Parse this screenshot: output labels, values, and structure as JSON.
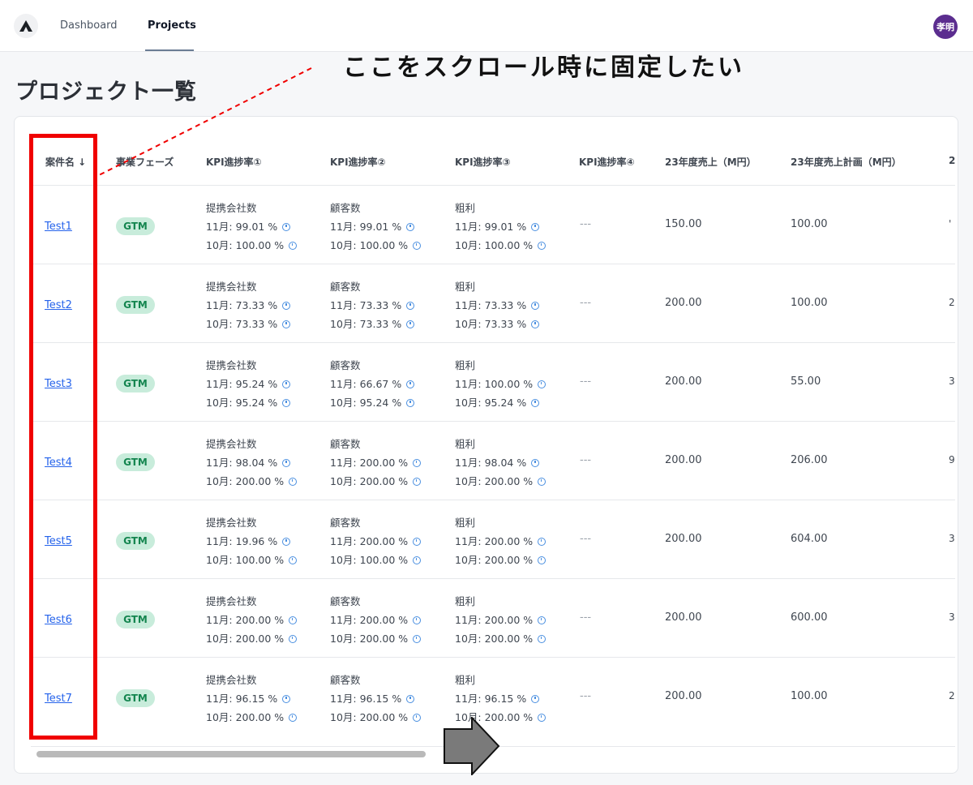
{
  "nav": {
    "dashboard": "Dashboard",
    "projects": "Projects",
    "avatar": "孝明"
  },
  "page": {
    "title": "プロジェクト一覧"
  },
  "annotation": {
    "text": "ここをスクロール時に固定したい"
  },
  "table": {
    "headers": {
      "name": "案件名 ↓",
      "phase": "事業フェーズ",
      "kpi1": "KPI進捗率①",
      "kpi2": "KPI進捗率②",
      "kpi3": "KPI進捗率③",
      "kpi4": "KPI進捗率④",
      "sales23": "23年度売上（M円）",
      "plan23": "23年度売上計画（M円）",
      "cut": "2"
    },
    "rows": [
      {
        "name": "Test1",
        "phase": "GTM",
        "kpi1": {
          "label": "提携会社数",
          "nov": "11月: 99.01 %",
          "oct": "10月: 100.00 %"
        },
        "kpi2": {
          "label": "顧客数",
          "nov": "11月: 99.01 %",
          "oct": "10月: 100.00 %"
        },
        "kpi3": {
          "label": "粗利",
          "nov": "11月: 99.01 %",
          "oct": "10月: 100.00 %"
        },
        "kpi4": "---",
        "sales": "150.00",
        "plan": "100.00",
        "cut": "'"
      },
      {
        "name": "Test2",
        "phase": "GTM",
        "kpi1": {
          "label": "提携会社数",
          "nov": "11月: 73.33 %",
          "oct": "10月: 73.33 %"
        },
        "kpi2": {
          "label": "顧客数",
          "nov": "11月: 73.33 %",
          "oct": "10月: 73.33 %"
        },
        "kpi3": {
          "label": "粗利",
          "nov": "11月: 73.33 %",
          "oct": "10月: 73.33 %"
        },
        "kpi4": "---",
        "sales": "200.00",
        "plan": "100.00",
        "cut": "2"
      },
      {
        "name": "Test3",
        "phase": "GTM",
        "kpi1": {
          "label": "提携会社数",
          "nov": "11月: 95.24 %",
          "oct": "10月: 95.24 %"
        },
        "kpi2": {
          "label": "顧客数",
          "nov": "11月: 66.67 %",
          "oct": "10月: 95.24 %"
        },
        "kpi3": {
          "label": "粗利",
          "nov": "11月: 100.00 %",
          "oct": "10月: 95.24 %"
        },
        "kpi4": "---",
        "sales": "200.00",
        "plan": "55.00",
        "cut": "3"
      },
      {
        "name": "Test4",
        "phase": "GTM",
        "kpi1": {
          "label": "提携会社数",
          "nov": "11月: 98.04 %",
          "oct": "10月: 200.00 %"
        },
        "kpi2": {
          "label": "顧客数",
          "nov": "11月: 200.00 %",
          "oct": "10月: 200.00 %"
        },
        "kpi3": {
          "label": "粗利",
          "nov": "11月: 98.04 %",
          "oct": "10月: 200.00 %"
        },
        "kpi4": "---",
        "sales": "200.00",
        "plan": "206.00",
        "cut": "9"
      },
      {
        "name": "Test5",
        "phase": "GTM",
        "kpi1": {
          "label": "提携会社数",
          "nov": "11月: 19.96 %",
          "oct": "10月: 100.00 %"
        },
        "kpi2": {
          "label": "顧客数",
          "nov": "11月: 200.00 %",
          "oct": "10月: 100.00 %"
        },
        "kpi3": {
          "label": "粗利",
          "nov": "11月: 200.00 %",
          "oct": "10月: 200.00 %"
        },
        "kpi4": "---",
        "sales": "200.00",
        "plan": "604.00",
        "cut": "3"
      },
      {
        "name": "Test6",
        "phase": "GTM",
        "kpi1": {
          "label": "提携会社数",
          "nov": "11月: 200.00 %",
          "oct": "10月: 200.00 %"
        },
        "kpi2": {
          "label": "顧客数",
          "nov": "11月: 200.00 %",
          "oct": "10月: 200.00 %"
        },
        "kpi3": {
          "label": "粗利",
          "nov": "11月: 200.00 %",
          "oct": "10月: 200.00 %"
        },
        "kpi4": "---",
        "sales": "200.00",
        "plan": "600.00",
        "cut": "3"
      },
      {
        "name": "Test7",
        "phase": "GTM",
        "kpi1": {
          "label": "提携会社数",
          "nov": "11月: 96.15 %",
          "oct": "10月: 200.00 %"
        },
        "kpi2": {
          "label": "顧客数",
          "nov": "11月: 96.15 %",
          "oct": "10月: 200.00 %"
        },
        "kpi3": {
          "label": "粗利",
          "nov": "11月: 96.15 %",
          "oct": "10月: 200.00 %"
        },
        "kpi4": "---",
        "sales": "200.00",
        "plan": "100.00",
        "cut": "2"
      }
    ]
  }
}
